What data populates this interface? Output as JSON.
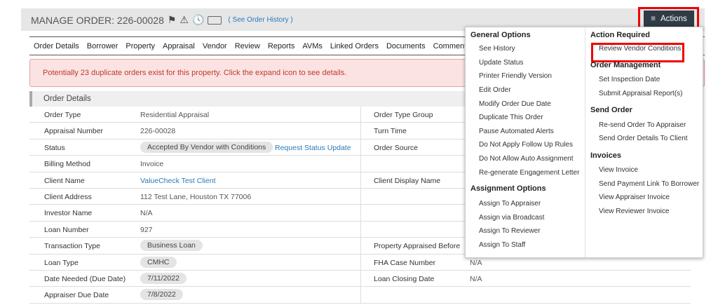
{
  "header": {
    "title": "MANAGE ORDER: 226-00028",
    "history_link": "( See Order History )",
    "actions_label": "Actions"
  },
  "tabs": [
    "Order Details",
    "Borrower",
    "Property",
    "Appraisal",
    "Vendor",
    "Review",
    "Reports",
    "AVMs",
    "Linked Orders",
    "Documents",
    "Comments"
  ],
  "alert": "Potentially 23 duplicate orders exist for this property. Click the expand icon to see details.",
  "section_title": "Order Details",
  "rows": [
    {
      "label": "Order Type",
      "value": "Residential Appraisal",
      "right_label": "Order Type Group",
      "right_value": ""
    },
    {
      "label": "Appraisal Number",
      "value": "226-00028",
      "right_label": "Turn Time",
      "right_value": ""
    },
    {
      "label": "Status",
      "value": "Accepted By Vendor with Conditions",
      "link": "Request Status Update",
      "right_label": "Order Source",
      "right_value": ""
    },
    {
      "label": "Billing Method",
      "value": "Invoice",
      "right_label": "",
      "right_value": ""
    },
    {
      "label": "Client Name",
      "value": "ValueCheck Test Client",
      "right_label": "Client Display Name",
      "right_value": ""
    },
    {
      "label": "Client Address",
      "value": "112 Test Lane, Houston TX 77006",
      "right_label": "",
      "right_value": ""
    },
    {
      "label": "Investor Name",
      "value": "N/A",
      "right_label": "",
      "right_value": ""
    },
    {
      "label": "Loan Number",
      "value": "927",
      "right_label": "",
      "right_value": ""
    },
    {
      "label": "Transaction Type",
      "value": "Business Loan",
      "right_label": "Property Appraised Before",
      "right_value": ""
    },
    {
      "label": "Loan Type",
      "value": "CMHC",
      "right_label": "FHA Case Number",
      "right_value": "N/A"
    },
    {
      "label": "Date Needed (Due Date)",
      "value": "7/11/2022",
      "right_label": "Loan Closing Date",
      "right_value": "N/A"
    },
    {
      "label": "Appraiser Due Date",
      "value": "7/8/2022",
      "right_label": "",
      "right_value": ""
    }
  ],
  "menu": {
    "general": {
      "title": "General Options",
      "items": [
        "See History",
        "Update Status",
        "Printer Friendly Version",
        "Edit Order",
        "Modify Order Due Date",
        "Duplicate This Order",
        "Pause Automated Alerts",
        "Do Not Apply Follow Up Rules",
        "Do Not Allow Auto Assignment",
        "Re-generate Engagement Letter"
      ]
    },
    "assignment": {
      "title": "Assignment Options",
      "items": [
        "Assign To Appraiser",
        "Assign via Broadcast",
        "Assign To Reviewer",
        "Assign To Staff"
      ]
    },
    "action_required": {
      "title": "Action Required",
      "items": [
        "Review Vendor Conditions"
      ]
    },
    "order_management": {
      "title": "Order Management",
      "items": [
        "Set Inspection Date",
        "Submit Appraisal Report(s)"
      ]
    },
    "send_order": {
      "title": "Send Order",
      "items": [
        "Re-send Order To Appraiser",
        "Send Order Details To Client"
      ]
    },
    "invoices": {
      "title": "Invoices",
      "items": [
        "View Invoice",
        "Send Payment Link To Borrower",
        "View Appraiser Invoice",
        "View Reviewer Invoice"
      ]
    }
  },
  "colors": {
    "highlight": "#ee0000",
    "actions_bg": "#2f3b45",
    "link": "#2a7ab8",
    "alert_text": "#c0392b"
  }
}
